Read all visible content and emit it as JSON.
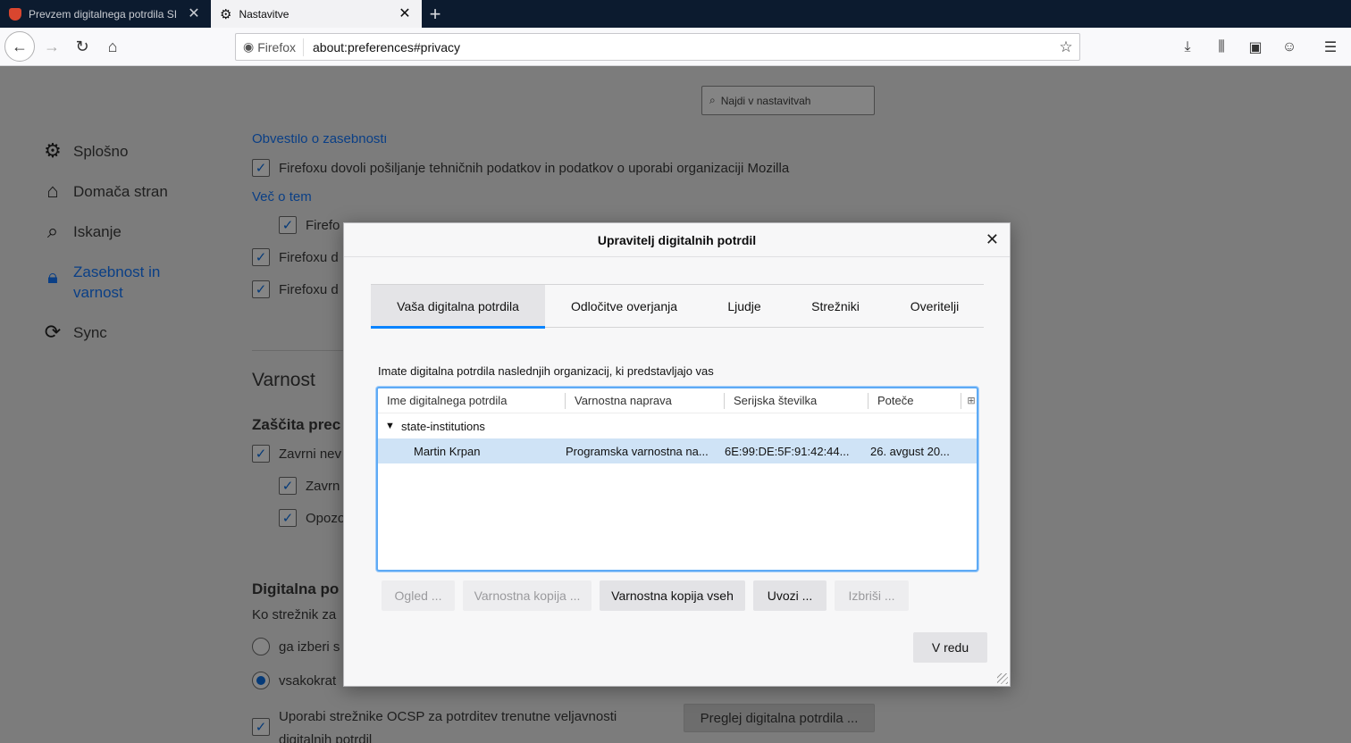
{
  "tabs": [
    {
      "title": "Prevzem digitalnega potrdila SI",
      "active": false,
      "icon": "shield-icon"
    },
    {
      "title": "Nastavitve",
      "active": true,
      "icon": "gear-icon"
    }
  ],
  "navbar": {
    "identity_label": "Firefox",
    "url": "about:preferences#privacy"
  },
  "prefs": {
    "search_placeholder": "Najdi v nastavitvah",
    "categories": [
      {
        "label": "Splošno",
        "icon": "gear-icon"
      },
      {
        "label": "Domača stran",
        "icon": "home-icon"
      },
      {
        "label": "Iskanje",
        "icon": "search-icon"
      },
      {
        "label": "Zasebnost in varnost",
        "icon": "lock-icon",
        "selected": true
      },
      {
        "label": "Sync",
        "icon": "sync-icon"
      }
    ],
    "partial_link_top": "Obvestilo o zasebnosti",
    "telemetry_label": "Firefoxu dovoli pošiljanje tehničnih podatkov in podatkov o uporabi organizaciji Mozilla",
    "more_link": "Več o tem",
    "sub1": "Firefo",
    "sub2": "Firefoxu d",
    "sub3": "Firefoxu d",
    "security_heading": "Varnost",
    "protection_heading": "Zaščita prec",
    "block_label": "Zavrni nev",
    "block_sub1": "Zavrn",
    "block_sub2": "Opozo",
    "certs_heading": "Digitalna po",
    "certs_question": "Ko strežnik za",
    "radio_auto": "ga izberi s",
    "radio_ask": "vsakokrat ",
    "ocsp_label_1": "Uporabi strežnike OCSP za potrditev trenutne veljavnosti",
    "ocsp_label_2": "digitalnih potrdil",
    "view_certs_button": "Preglej digitalna potrdila ..."
  },
  "dialog": {
    "title": "Upravitelj digitalnih potrdil",
    "tabs": [
      "Vaša digitalna potrdila",
      "Odločitve overjanja",
      "Ljudje",
      "Strežniki",
      "Overitelji"
    ],
    "active_tab": 0,
    "description": "Imate digitalna potrdila naslednjih organizacij, ki predstavljajo vas",
    "columns": [
      "Ime digitalnega potrdila",
      "Varnostna naprava",
      "Serijska številka",
      "Poteče"
    ],
    "group": "state-institutions",
    "rows": [
      {
        "name": "Martin Krpan",
        "device": "Programska varnostna na...",
        "serial": "6E:99:DE:5F:91:42:44...",
        "expires": "26. avgust 20..."
      }
    ],
    "buttons": [
      {
        "label": "Ogled ...",
        "disabled": true
      },
      {
        "label": "Varnostna kopija ...",
        "disabled": true
      },
      {
        "label": "Varnostna kopija vseh",
        "disabled": false
      },
      {
        "label": "Uvozi ...",
        "disabled": false
      },
      {
        "label": "Izbriši ...",
        "disabled": true
      }
    ],
    "ok_label": "V redu"
  }
}
